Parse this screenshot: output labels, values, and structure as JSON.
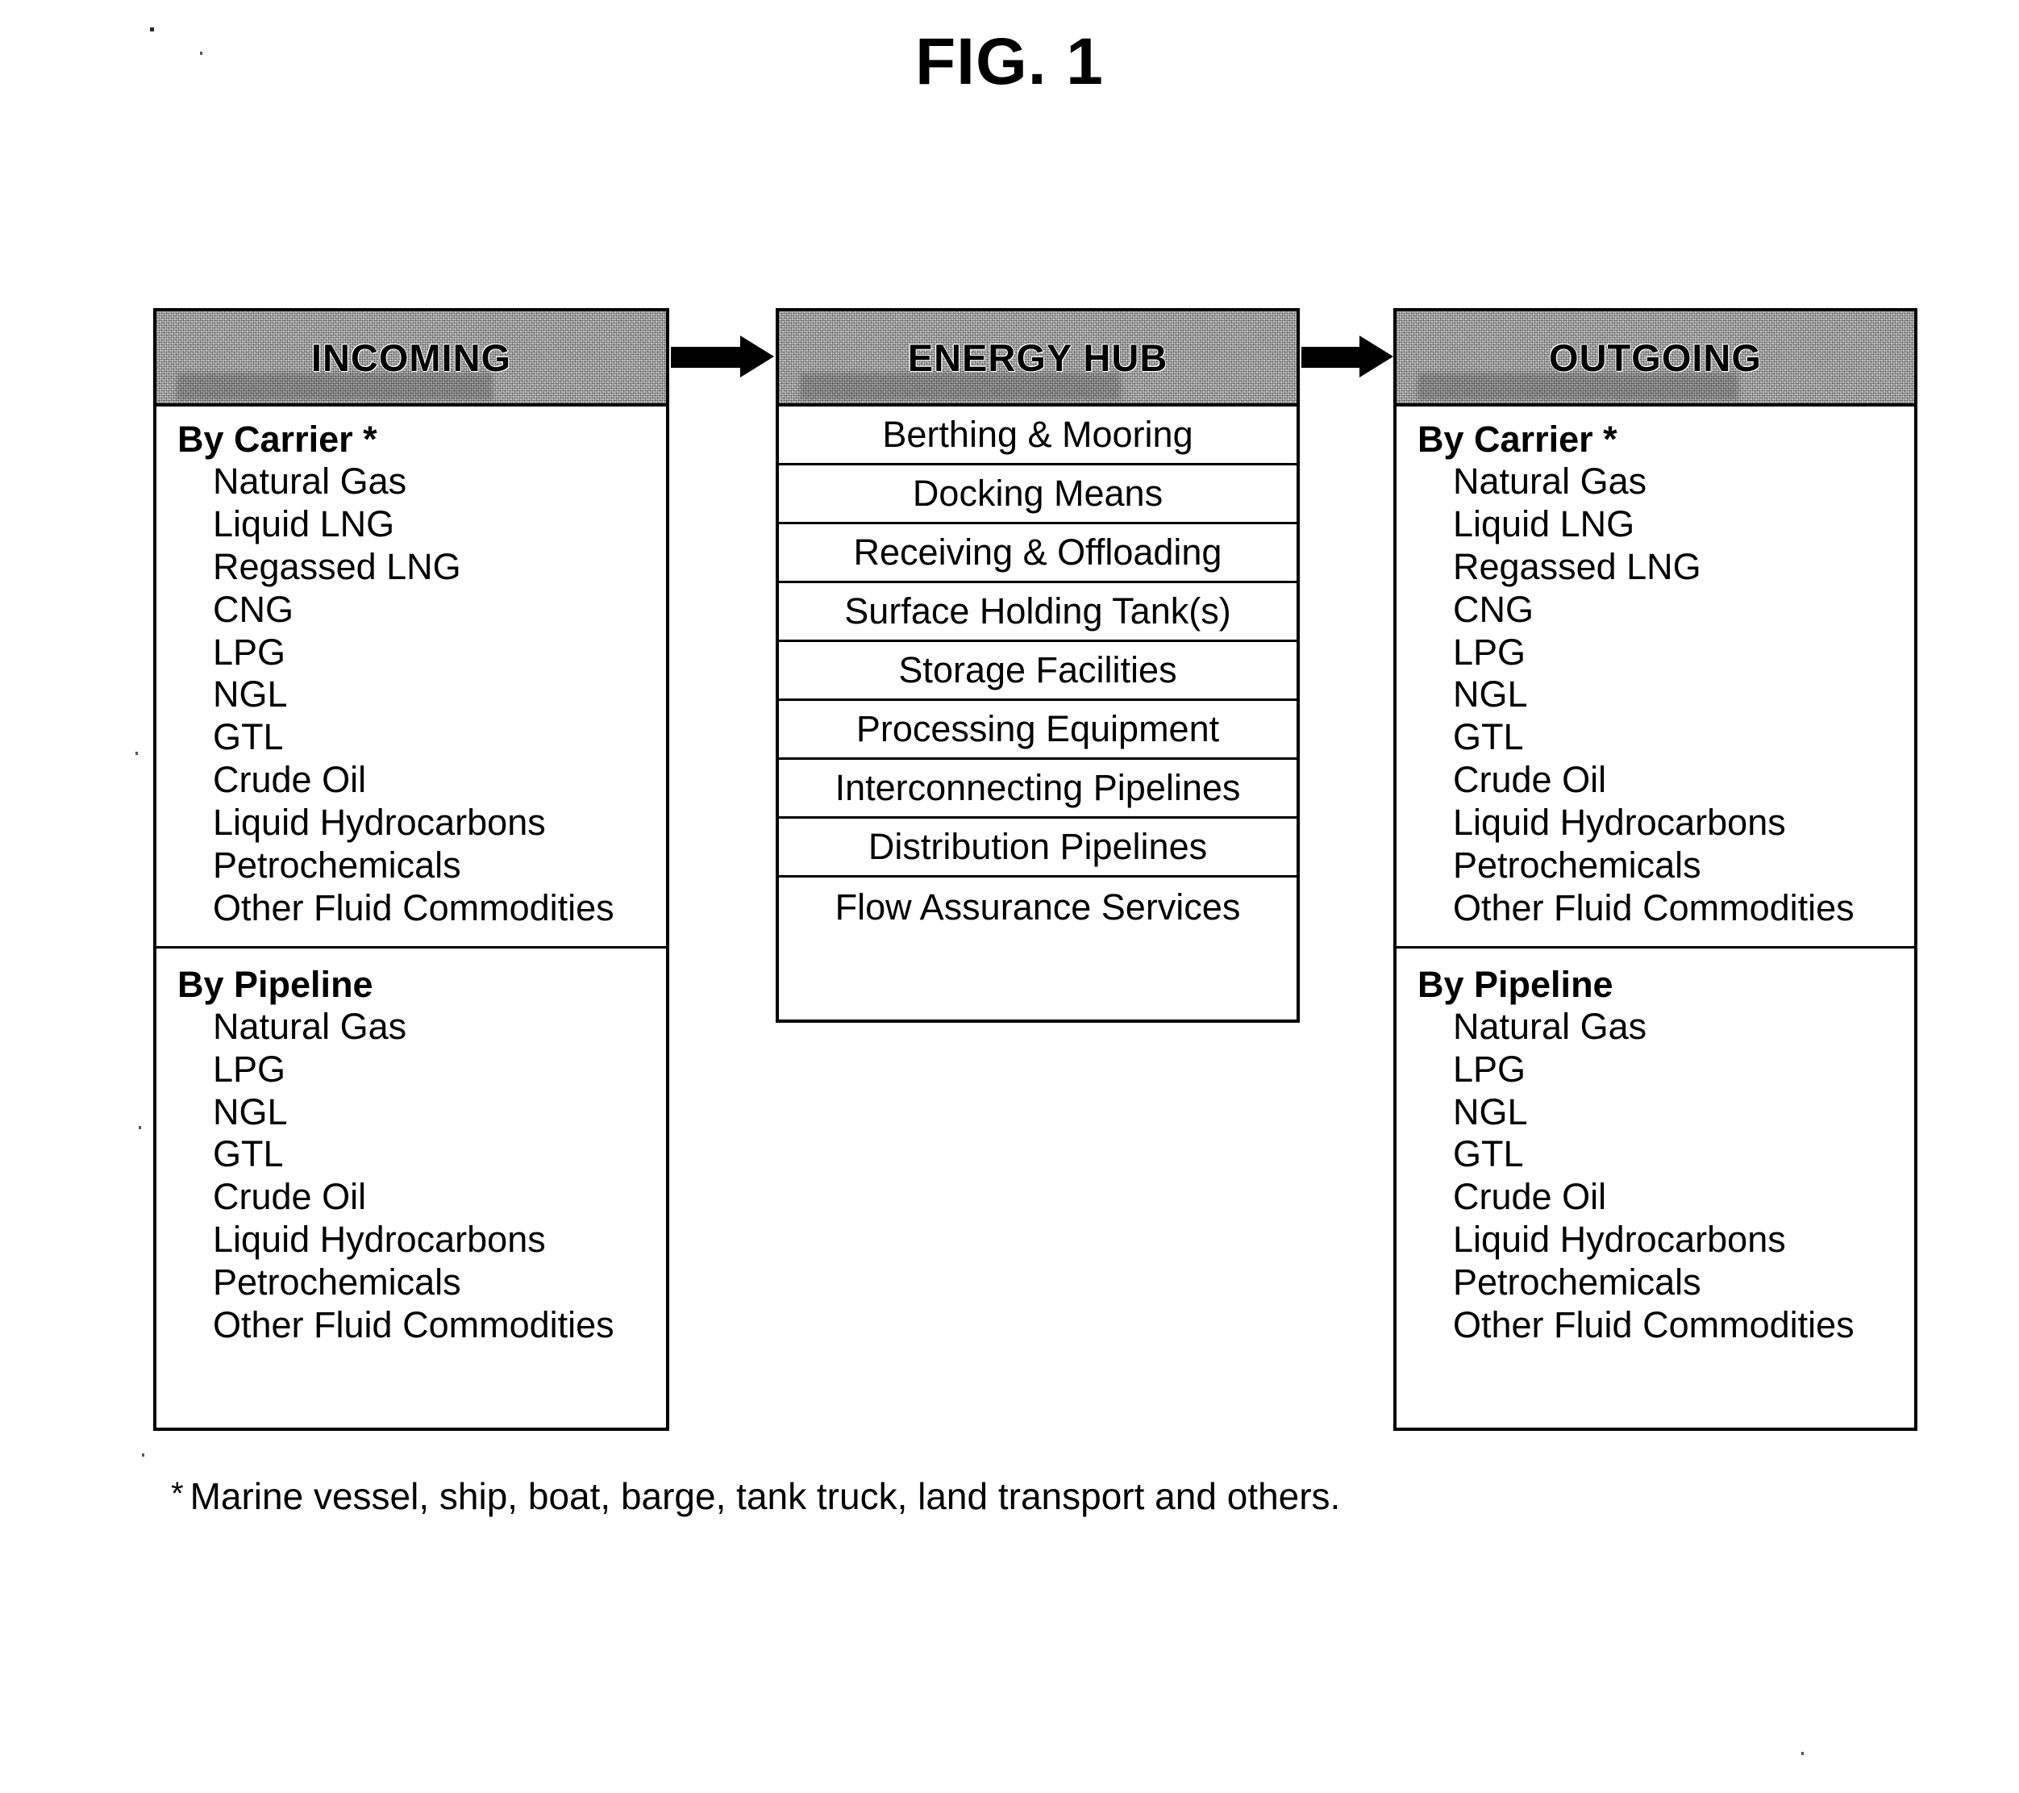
{
  "figure": {
    "title": "FIG. 1",
    "footnote_marker": "*",
    "footnote_text": "Marine vessel, ship, boat, barge, tank truck, land transport and others."
  },
  "colors": {
    "header_fill": "#c9c9c9",
    "line": "#000000",
    "background": "#ffffff"
  },
  "columns": {
    "incoming": {
      "header": "INCOMING",
      "carrier": {
        "title": "By Carrier *",
        "items": [
          "Natural Gas",
          "Liquid LNG",
          "Regassed LNG",
          "CNG",
          "LPG",
          "NGL",
          "GTL",
          "Crude Oil",
          "Liquid Hydrocarbons",
          "Petrochemicals",
          "Other Fluid Commodities"
        ]
      },
      "pipeline": {
        "title": "By Pipeline",
        "items": [
          "Natural Gas",
          "LPG",
          "NGL",
          "GTL",
          "Crude Oil",
          "Liquid Hydrocarbons",
          "Petrochemicals",
          "Other Fluid Commodities"
        ]
      }
    },
    "hub": {
      "header": "ENERGY HUB",
      "rows": [
        "Berthing & Mooring",
        "Docking Means",
        "Receiving & Offloading",
        "Surface Holding Tank(s)",
        "Storage Facilities",
        "Processing Equipment",
        "Interconnecting Pipelines",
        "Distribution Pipelines",
        "Flow Assurance Services"
      ]
    },
    "outgoing": {
      "header": "OUTGOING",
      "carrier": {
        "title": "By Carrier *",
        "items": [
          "Natural Gas",
          "Liquid LNG",
          "Regassed LNG",
          "CNG",
          "LPG",
          "NGL",
          "GTL",
          "Crude Oil",
          "Liquid Hydrocarbons",
          "Petrochemicals",
          "Other Fluid Commodities"
        ]
      },
      "pipeline": {
        "title": "By Pipeline",
        "items": [
          "Natural Gas",
          "LPG",
          "NGL",
          "GTL",
          "Crude Oil",
          "Liquid Hydrocarbons",
          "Petrochemicals",
          "Other Fluid Commodities"
        ]
      }
    }
  },
  "flow": {
    "arrow_1_label": "incoming-to-hub",
    "arrow_2_label": "hub-to-outgoing"
  }
}
